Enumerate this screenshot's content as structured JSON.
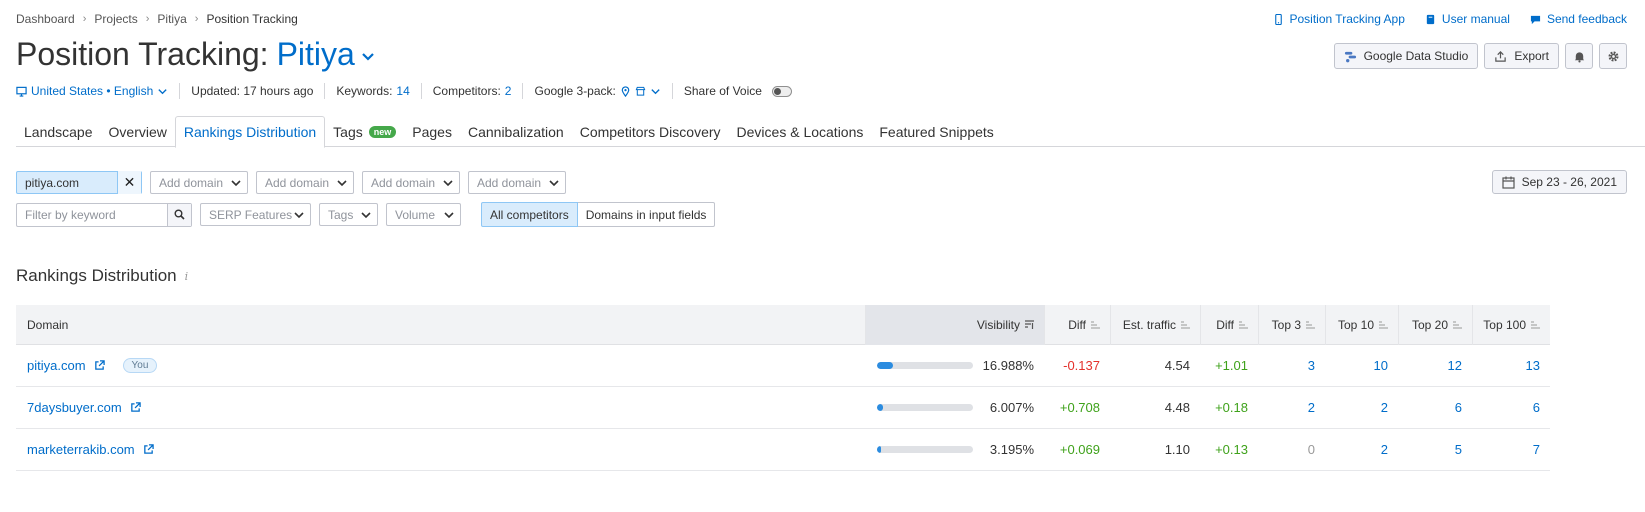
{
  "breadcrumb": [
    "Dashboard",
    "Projects",
    "Pitiya",
    "Position Tracking"
  ],
  "top_links": {
    "app": "Position Tracking App",
    "manual": "User manual",
    "feedback": "Send feedback"
  },
  "title": {
    "prefix": "Position Tracking:",
    "project": "Pitiya"
  },
  "actions": {
    "gds": "Google Data Studio",
    "export": "Export"
  },
  "meta": {
    "location": "United States • English",
    "updated": "Updated: 17 hours ago",
    "keywords_label": "Keywords:",
    "keywords_value": "14",
    "competitors_label": "Competitors:",
    "competitors_value": "2",
    "pack_label": "Google 3-pack:",
    "sov_label": "Share of Voice"
  },
  "tabs": [
    "Landscape",
    "Overview",
    "Rankings Distribution",
    "Tags",
    "Pages",
    "Cannibalization",
    "Competitors Discovery",
    "Devices & Locations",
    "Featured Snippets"
  ],
  "tags_badge": "new",
  "filters": {
    "domain_value": "pitiya.com",
    "add_domain": "Add domain",
    "date_range": "Sep 23 - 26, 2021",
    "keyword_placeholder": "Filter by keyword",
    "serp": "SERP Features",
    "tags": "Tags",
    "volume": "Volume",
    "all_competitors": "All competitors",
    "domains_inputs": "Domains in input fields"
  },
  "section_title": "Rankings Distribution",
  "table": {
    "headers": [
      "Domain",
      "Visibility",
      "Diff",
      "Est. traffic",
      "Diff",
      "Top 3",
      "Top 10",
      "Top 20",
      "Top 100"
    ],
    "you_badge": "You",
    "rows": [
      {
        "domain": "pitiya.com",
        "you": true,
        "vis_fraction": 0.17,
        "visibility": "16.988%",
        "diff": "-0.137",
        "diff_type": "neg",
        "traffic": "4.54",
        "tdiff": "+1.01",
        "top3": "3",
        "top10": "10",
        "top20": "12",
        "top100": "13"
      },
      {
        "domain": "7daysbuyer.com",
        "you": false,
        "vis_fraction": 0.06,
        "visibility": "6.007%",
        "diff": "+0.708",
        "diff_type": "pos",
        "traffic": "4.48",
        "tdiff": "+0.18",
        "top3": "2",
        "top10": "2",
        "top20": "6",
        "top100": "6"
      },
      {
        "domain": "marketerrakib.com",
        "you": false,
        "vis_fraction": 0.032,
        "visibility": "3.195%",
        "diff": "+0.069",
        "diff_type": "pos",
        "traffic": "1.10",
        "tdiff": "+0.13",
        "top3": "0",
        "top10": "2",
        "top20": "5",
        "top100": "7"
      }
    ]
  }
}
